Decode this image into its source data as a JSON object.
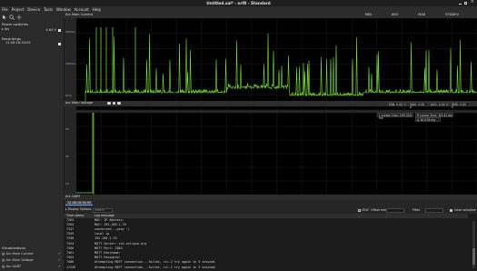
{
  "window": {
    "title": "Untitled.sal* - nrf8 - Standard"
  },
  "menu": [
    "File",
    "Project",
    "Device",
    "Tools",
    "Window",
    "Account",
    "Help"
  ],
  "sidebar": {
    "power_switches_heading": "Power switches",
    "device_name": "Ibs",
    "device_value": "4.64 V",
    "recordings_heading": "Recordings",
    "recording_name": "12:08:18:34:05",
    "visualizations_heading": "Visualizations",
    "visualizations": [
      "Arc Main Current",
      "Arc Main Voltage",
      "Arc UART"
    ]
  },
  "panel1": {
    "title": "Arc Main Current",
    "stat_headers": [
      "MIN",
      "AVG",
      "MAX",
      "STDDEV"
    ],
    "stat_values": [
      "0.00 A",
      "0.00 A",
      "0.00 A",
      "0.00 A"
    ],
    "delta": "Δ 11.074 m",
    "y_labels": [
      "200mA",
      "100mA",
      "0mA"
    ]
  },
  "panel2": {
    "title": "Arc Main Voltage",
    "stat_values": [
      "MIN: 0.00 V",
      "MAX: 0.00 V",
      "AVG: 0.00 V",
      "RMS: 0.00 V"
    ],
    "cursor_left": "L cursor 1ms: 195.324 ms",
    "cursor_right": "R cursor 2ms: 1(5.4) ms",
    "delta": "Δ 10.078 ms",
    "y_labels": [
      "5V",
      "3V",
      "1V"
    ]
  },
  "uart": {
    "title": "Arc UART",
    "recording_tab": "12:08:18:34:05",
    "display_options": "Display Options",
    "search_placeholder": "Search",
    "crlf_label": "CRLF",
    "offset_label": "Offset min",
    "filter_label": "Filter",
    "case_label": "Case sensitive",
    "columns": [
      "Time stamp",
      "Log message"
    ],
    "rows": [
      {
        "t": "7264",
        "m": "MAC: IP Address:"
      },
      {
        "t": "7264",
        "m": "MAC: 192.168.1.70"
      },
      {
        "t": "7347",
        "m": "connected...yeay :)"
      },
      {
        "t": "7349",
        "m": "local ip"
      },
      {
        "t": "7350",
        "m": "192.168.1.70"
      },
      {
        "t": "7454",
        "m": "MQTT Server: iot.eclipse.org"
      },
      {
        "t": "7456",
        "m": "MQTT Port: 1883"
      },
      {
        "t": "7461",
        "m": "MQTT Username:"
      },
      {
        "t": "7464",
        "m": "MQTT Password:"
      },
      {
        "t": "7466",
        "m": "Attempting MQTT connection...failed, rc=-2 try again in 5 seconds"
      },
      {
        "t": "17439",
        "m": "Attempting MQTT connection...failed, rc=-2 try again in 5 seconds"
      }
    ]
  },
  "colors": {
    "trace": "#7be03a",
    "bg": "#262626",
    "plot": "#000000"
  }
}
